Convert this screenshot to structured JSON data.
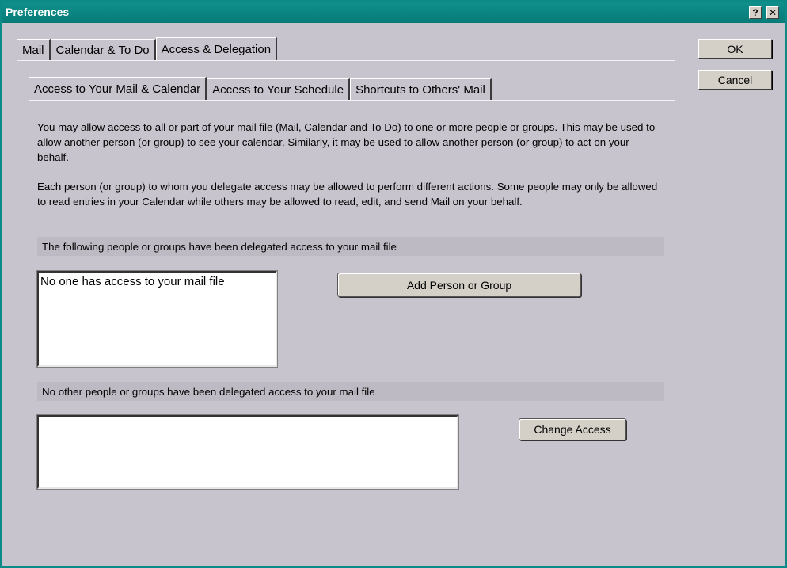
{
  "window": {
    "title": "Preferences",
    "help_glyph": "?",
    "close_glyph": "✕"
  },
  "main_tabs": [
    {
      "label": "Mail",
      "active": false
    },
    {
      "label": "Calendar & To Do",
      "active": false
    },
    {
      "label": "Access & Delegation",
      "active": true
    }
  ],
  "sub_tabs": [
    {
      "label": "Access to Your Mail & Calendar",
      "active": true
    },
    {
      "label": "Access to Your Schedule",
      "active": false
    },
    {
      "label": "Shortcuts to Others' Mail",
      "active": false
    }
  ],
  "buttons": {
    "ok": "OK",
    "cancel": "Cancel",
    "add_person": "Add Person or Group",
    "change_access": "Change Access"
  },
  "description": {
    "p1": "You may allow access to all or part of your mail file (Mail, Calendar and To Do) to one or more people or groups. This may be used to allow another person (or group) to see your calendar. Similarly, it may be used to allow another person (or group) to act on your behalf.",
    "p2": "Each person (or group) to whom you delegate access may be allowed to perform different actions. Some people may only be allowed to read entries in your Calendar while others may be allowed to read, edit, and send Mail on your behalf."
  },
  "delegated_section": {
    "header": "The following people or groups have been delegated access to your mail file",
    "items": [
      "No one has access to your mail file"
    ]
  },
  "other_section": {
    "header": "No other people or groups have been delegated access to your mail file",
    "items": []
  }
}
